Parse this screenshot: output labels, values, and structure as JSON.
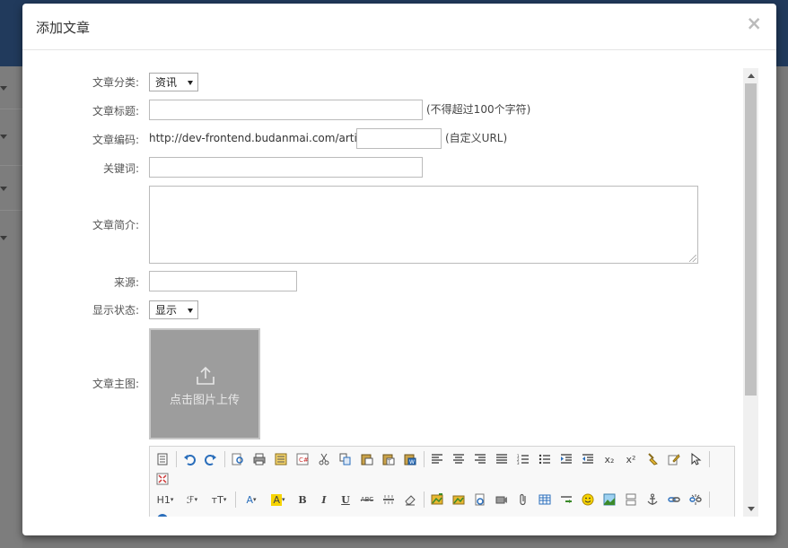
{
  "modal": {
    "title": "添加文章",
    "close_symbol": "×"
  },
  "form": {
    "category": {
      "label": "文章分类:",
      "selected": "资讯"
    },
    "title": {
      "label": "文章标题:",
      "value": "",
      "hint": "(不得超过100个字符)"
    },
    "code": {
      "label": "文章编码:",
      "prefix": "http://dev-frontend.budanmai.com/article/",
      "value": "",
      "hint": "(自定义URL)"
    },
    "keywords": {
      "label": "关键词:",
      "value": ""
    },
    "summary": {
      "label": "文章简介:",
      "value": ""
    },
    "source": {
      "label": "来源:",
      "value": ""
    },
    "status": {
      "label": "显示状态:",
      "selected": "显示"
    },
    "image": {
      "label": "文章主图:",
      "upload_text": "点击图片上传"
    }
  },
  "editor": {
    "toolbar_text": {
      "heading": "H1",
      "font": "ℱ",
      "font_size": "тT",
      "font_color": "A",
      "bg_color": "A",
      "bold": "B",
      "italic": "I",
      "underline": "U",
      "strike": "ABC",
      "subscript": "x₂",
      "superscript": "x²"
    }
  },
  "colors": {
    "overlay": "#7a7a7a",
    "topbar": "#213a5c",
    "upload_bg": "#9d9d9d",
    "accent_blue": "#2a6ebb"
  }
}
